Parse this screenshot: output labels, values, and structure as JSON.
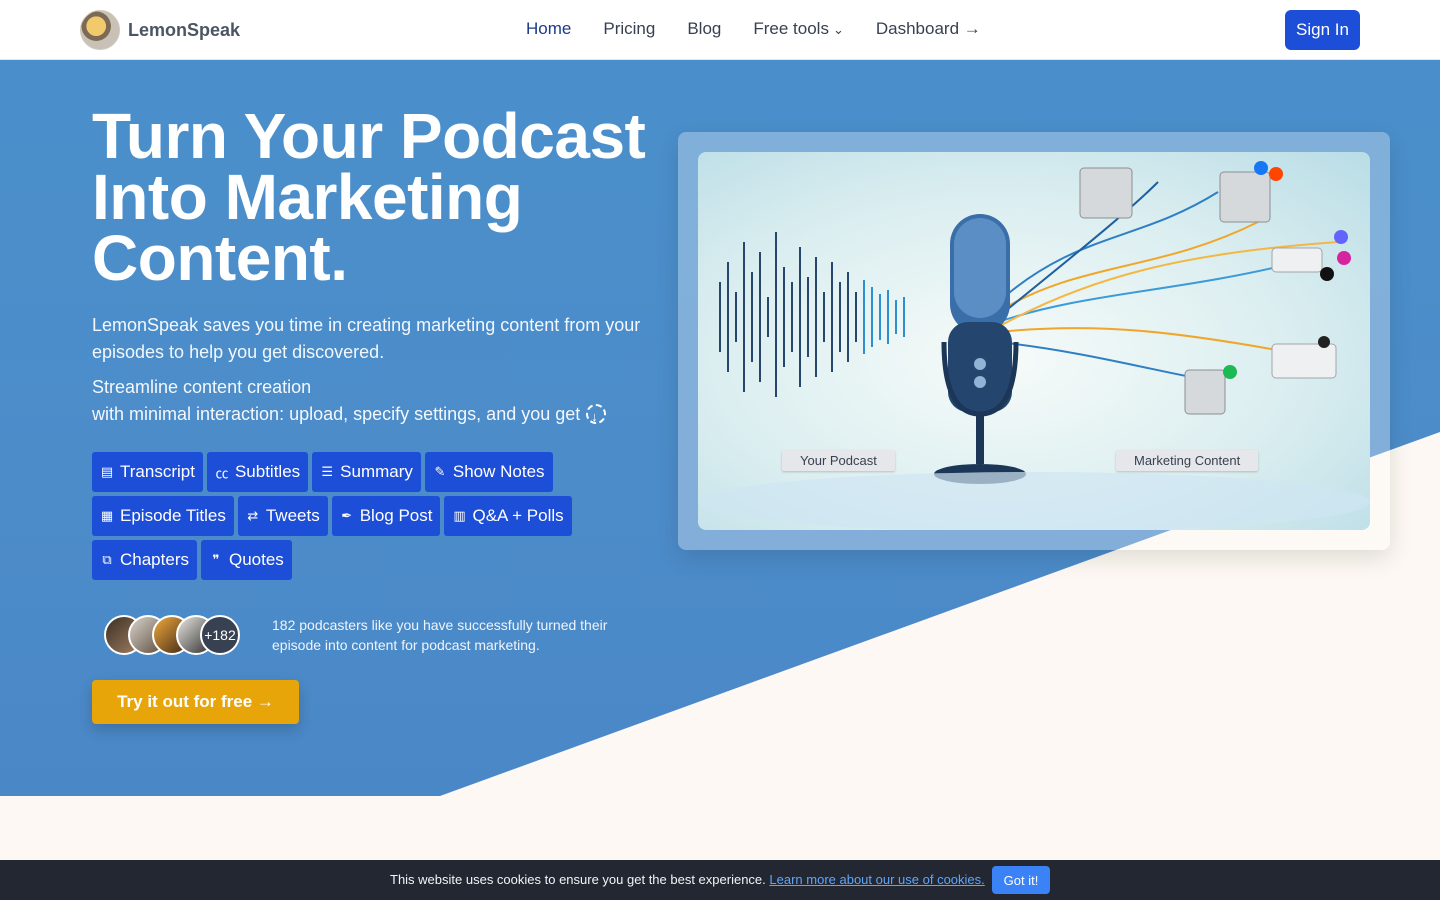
{
  "nav": {
    "brand": "LemonSpeak",
    "links": [
      {
        "label": "Home"
      },
      {
        "label": "Pricing"
      },
      {
        "label": "Blog"
      },
      {
        "label": "Free tools"
      },
      {
        "label": "Dashboard →"
      }
    ],
    "signin": "Sign In"
  },
  "hero": {
    "title": "Turn Your Podcast Into Marketing Content.",
    "lead": "LemonSpeak saves you time in creating marketing content from your episodes to help you get discovered.",
    "lead2_line1": "Streamline content creation",
    "lead2_line2": "with minimal interaction: upload, specify settings, and you get",
    "chips": [
      {
        "label": "Transcript",
        "icon": "transcript-icon"
      },
      {
        "label": "Subtitles",
        "icon": "cc-icon"
      },
      {
        "label": "Summary",
        "icon": "summary-icon"
      },
      {
        "label": "Show Notes",
        "icon": "notes-icon"
      },
      {
        "label": "Episode Titles",
        "icon": "clipboard-icon"
      },
      {
        "label": "Tweets",
        "icon": "retweet-icon"
      },
      {
        "label": "Blog Post",
        "icon": "pen-icon"
      },
      {
        "label": "Q&A + Polls",
        "icon": "poll-icon"
      },
      {
        "label": "Chapters",
        "icon": "chapters-icon"
      },
      {
        "label": "Quotes",
        "icon": "quote-icon"
      }
    ],
    "avatar_count": "+182",
    "social_proof": "182 podcasters like you have successfully turned their episode into content for podcast marketing.",
    "cta": "Try it out for free →",
    "image_labels": {
      "left": "Your Podcast",
      "right": "Marketing Content"
    }
  },
  "cookie": {
    "text": "This website uses cookies to ensure you get the best experience.",
    "link": "Learn more about our use of cookies.",
    "button": "Got it!"
  },
  "colors": {
    "primary": "#1d4ed8",
    "hero": "#4a8fcb",
    "cta": "#e8a50a",
    "cream": "#fdf8f3"
  }
}
